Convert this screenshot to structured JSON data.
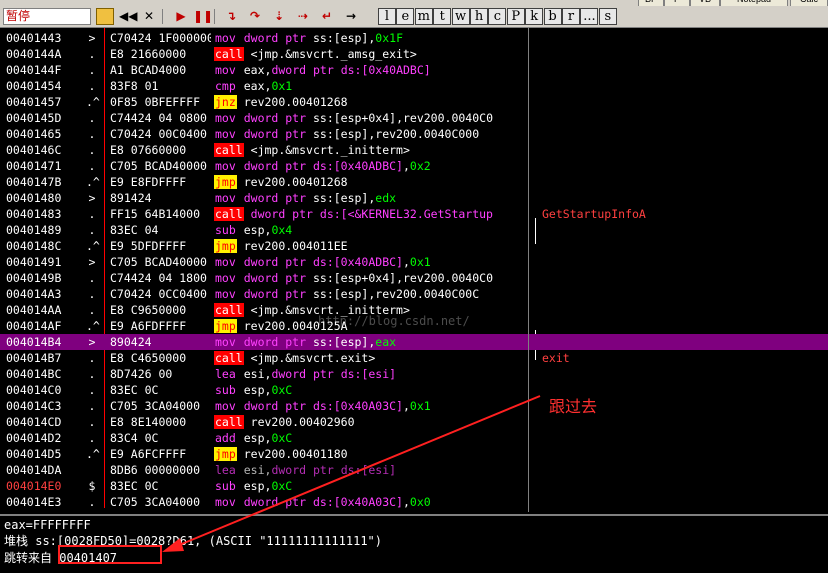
{
  "top_buttons": [
    "BP",
    "P",
    "VB",
    "Notepad",
    "Calc"
  ],
  "toolbar": {
    "status": "暂停",
    "letters": [
      "l",
      "e",
      "m",
      "t",
      "w",
      "h",
      "c",
      "P",
      "k",
      "b",
      "r",
      "...",
      "s"
    ]
  },
  "rows": [
    {
      "addr": "00401443",
      "mark": ">",
      "hex": "C70424 1F000000",
      "mn": "mov",
      "mnc": "mov",
      "ops": [
        [
          "dword ptr ",
          "kw"
        ],
        [
          "ss:[esp]",
          "reg"
        ],
        [
          ",",
          "reg"
        ],
        [
          "0x1F",
          "num"
        ]
      ],
      "comment": ""
    },
    {
      "addr": "0040144A",
      "mark": ".",
      "hex": "E8 21660000",
      "mn": "call",
      "mnc": "call",
      "ops": [
        [
          "<jmp.&msvcrt._amsg_exit>",
          "lbl"
        ]
      ],
      "comment": ""
    },
    {
      "addr": "0040144F",
      "mark": ".",
      "hex": "A1 BCAD4000",
      "mn": "mov",
      "mnc": "mov",
      "ops": [
        [
          "eax",
          "reg"
        ],
        [
          ",",
          "reg"
        ],
        [
          "dword ptr ",
          "kw"
        ],
        [
          "ds:[0x40ADBC]",
          "kw"
        ]
      ],
      "comment": ""
    },
    {
      "addr": "00401454",
      "mark": ".",
      "hex": "83F8 01",
      "mn": "cmp",
      "mnc": "cmp",
      "ops": [
        [
          "eax",
          "reg"
        ],
        [
          ",",
          "reg"
        ],
        [
          "0x1",
          "num"
        ]
      ],
      "comment": ""
    },
    {
      "addr": "00401457",
      "mark": ".^",
      "hex": "0F85 0BFEFFFF",
      "mn": "jnz",
      "mnc": "jcc",
      "ops": [
        [
          "rev200.00401268",
          "lbl"
        ]
      ],
      "comment": ""
    },
    {
      "addr": "0040145D",
      "mark": ".",
      "hex": "C74424 04 0800",
      "mn": "mov",
      "mnc": "mov",
      "ops": [
        [
          "dword ptr ",
          "kw"
        ],
        [
          "ss:[esp+0x4]",
          "reg"
        ],
        [
          ",rev200.0040C0",
          "reg"
        ]
      ],
      "comment": ""
    },
    {
      "addr": "00401465",
      "mark": ".",
      "hex": "C70424 00C0400",
      "mn": "mov",
      "mnc": "mov",
      "ops": [
        [
          "dword ptr ",
          "kw"
        ],
        [
          "ss:[esp]",
          "reg"
        ],
        [
          ",rev200.0040C000",
          "reg"
        ]
      ],
      "comment": ""
    },
    {
      "addr": "0040146C",
      "mark": ".",
      "hex": "E8 07660000",
      "mn": "call",
      "mnc": "call",
      "ops": [
        [
          "<jmp.&msvcrt._initterm>",
          "lbl"
        ]
      ],
      "comment": ""
    },
    {
      "addr": "00401471",
      "mark": ".",
      "hex": "C705 BCAD40000",
      "mn": "mov",
      "mnc": "mov",
      "ops": [
        [
          "dword ptr ",
          "kw"
        ],
        [
          "ds:[0x40ADBC]",
          "kw"
        ],
        [
          ",",
          "reg"
        ],
        [
          "0x2",
          "num"
        ]
      ],
      "comment": ""
    },
    {
      "addr": "0040147B",
      "mark": ".^",
      "hex": "E9 E8FDFFFF",
      "mn": "jmp",
      "mnc": "jmp",
      "ops": [
        [
          "rev200.00401268",
          "lbl"
        ]
      ],
      "comment": ""
    },
    {
      "addr": "00401480",
      "mark": ">",
      "hex": "891424",
      "mn": "mov",
      "mnc": "mov",
      "ops": [
        [
          "dword ptr ",
          "kw"
        ],
        [
          "ss:[esp]",
          "reg"
        ],
        [
          ",",
          "reg"
        ],
        [
          "edx",
          "num"
        ]
      ],
      "comment": ""
    },
    {
      "addr": "00401483",
      "mark": ".",
      "hex": "FF15 64B14000",
      "mn": "call",
      "mnc": "call",
      "ops": [
        [
          "dword ptr ",
          "kw"
        ],
        [
          "ds:[<&KERNEL32.GetStartup",
          "kw"
        ]
      ],
      "comment": "GetStartupInfoA"
    },
    {
      "addr": "00401489",
      "mark": ".",
      "hex": "83EC 04",
      "mn": "sub",
      "mnc": "sub",
      "ops": [
        [
          "esp",
          "reg"
        ],
        [
          ",",
          "reg"
        ],
        [
          "0x4",
          "num"
        ]
      ],
      "comment": ""
    },
    {
      "addr": "0040148C",
      "mark": ".^",
      "hex": "E9 5DFDFFFF",
      "mn": "jmp",
      "mnc": "jmp",
      "ops": [
        [
          "rev200.004011EE",
          "lbl"
        ]
      ],
      "comment": ""
    },
    {
      "addr": "00401491",
      "mark": ">",
      "hex": "C705 BCAD40000",
      "mn": "mov",
      "mnc": "mov",
      "ops": [
        [
          "dword ptr ",
          "kw"
        ],
        [
          "ds:[0x40ADBC]",
          "kw"
        ],
        [
          ",",
          "reg"
        ],
        [
          "0x1",
          "num"
        ]
      ],
      "comment": ""
    },
    {
      "addr": "0040149B",
      "mark": ".",
      "hex": "C74424 04 1800",
      "mn": "mov",
      "mnc": "mov",
      "ops": [
        [
          "dword ptr ",
          "kw"
        ],
        [
          "ss:[esp+0x4]",
          "reg"
        ],
        [
          ",rev200.0040C0",
          "reg"
        ]
      ],
      "comment": ""
    },
    {
      "addr": "004014A3",
      "mark": ".",
      "hex": "C70424 0CC0400",
      "mn": "mov",
      "mnc": "mov",
      "ops": [
        [
          "dword ptr ",
          "kw"
        ],
        [
          "ss:[esp]",
          "reg"
        ],
        [
          ",rev200.0040C00C",
          "reg"
        ]
      ],
      "comment": ""
    },
    {
      "addr": "004014AA",
      "mark": ".",
      "hex": "E8 C9650000",
      "mn": "call",
      "mnc": "call",
      "ops": [
        [
          "<jmp.&msvcrt._initterm>",
          "lbl"
        ]
      ],
      "comment": ""
    },
    {
      "addr": "004014AF",
      "mark": ".^",
      "hex": "E9 A6FDFFFF",
      "mn": "jmp",
      "mnc": "jmp",
      "ops": [
        [
          "rev200.0040125A",
          "lbl"
        ]
      ],
      "comment": ""
    },
    {
      "addr": "004014B4",
      "mark": ">",
      "hex": "890424",
      "mn": "mov",
      "mnc": "mov",
      "ops": [
        [
          "dword ptr ",
          "kw"
        ],
        [
          "ss:[esp]",
          "reg"
        ],
        [
          ",",
          "reg"
        ],
        [
          "eax",
          "num"
        ]
      ],
      "comment": "",
      "selected": true
    },
    {
      "addr": "004014B7",
      "mark": ".",
      "hex": "E8 C4650000",
      "mn": "call",
      "mnc": "call",
      "ops": [
        [
          "<jmp.&msvcrt.exit>",
          "lbl"
        ]
      ],
      "comment": "exit"
    },
    {
      "addr": "004014BC",
      "mark": ".",
      "hex": "8D7426 00",
      "mn": "lea",
      "mnc": "lea",
      "ops": [
        [
          "esi",
          "reg"
        ],
        [
          ",",
          "reg"
        ],
        [
          "dword ptr ",
          "kw"
        ],
        [
          "ds:[esi]",
          "kw"
        ]
      ],
      "comment": ""
    },
    {
      "addr": "004014C0",
      "mark": ".",
      "hex": "83EC 0C",
      "mn": "sub",
      "mnc": "sub",
      "ops": [
        [
          "esp",
          "reg"
        ],
        [
          ",",
          "reg"
        ],
        [
          "0xC",
          "num"
        ]
      ],
      "comment": ""
    },
    {
      "addr": "004014C3",
      "mark": ".",
      "hex": "C705 3CA04000",
      "mn": "mov",
      "mnc": "mov",
      "ops": [
        [
          "dword ptr ",
          "kw"
        ],
        [
          "ds:[0x40A03C]",
          "kw"
        ],
        [
          ",",
          "reg"
        ],
        [
          "0x1",
          "num"
        ]
      ],
      "comment": ""
    },
    {
      "addr": "004014CD",
      "mark": ".",
      "hex": "E8 8E140000",
      "mn": "call",
      "mnc": "call",
      "ops": [
        [
          "rev200.00402960",
          "lbl"
        ]
      ],
      "comment": ""
    },
    {
      "addr": "004014D2",
      "mark": ".",
      "hex": "83C4 0C",
      "mn": "add",
      "mnc": "add",
      "ops": [
        [
          "esp",
          "reg"
        ],
        [
          ",",
          "reg"
        ],
        [
          "0xC",
          "num"
        ]
      ],
      "comment": ""
    },
    {
      "addr": "004014D5",
      "mark": ".^",
      "hex": "E9 A6FCFFFF",
      "mn": "jmp",
      "mnc": "jmp",
      "ops": [
        [
          "rev200.00401180",
          "lbl"
        ]
      ],
      "comment": ""
    },
    {
      "addr": "004014DA",
      "mark": "",
      "hex": "8DB6 00000000",
      "mn": "lea",
      "mnc": "lea",
      "ops": [
        [
          "esi",
          "reg"
        ],
        [
          ",",
          "reg"
        ],
        [
          "dword ptr ",
          "kw"
        ],
        [
          "ds:[esi]",
          "kw"
        ]
      ],
      "comment": "",
      "dim": true
    },
    {
      "addr": "004014E0",
      "mark": "$",
      "hex": "83EC 0C",
      "mn": "sub",
      "mnc": "sub",
      "ops": [
        [
          "esp",
          "reg"
        ],
        [
          ",",
          "reg"
        ],
        [
          "0xC",
          "num"
        ]
      ],
      "comment": "",
      "addr_red": true
    },
    {
      "addr": "004014E3",
      "mark": ".",
      "hex": "C705 3CA04000",
      "mn": "mov",
      "mnc": "mov",
      "ops": [
        [
          "dword ptr ",
          "kw"
        ],
        [
          "ds:[0x40A03C]",
          "kw"
        ],
        [
          ",",
          "reg"
        ],
        [
          "0x0",
          "num"
        ]
      ],
      "comment": ""
    }
  ],
  "info": {
    "line1": "eax=FFFFFFFF",
    "line2": "堆栈 ss:[0028FD50]=0028?D61, (ASCII \"11111111111111\")",
    "line3": "跳转来自 00401407"
  },
  "annotation": "跟过去",
  "watermark": "http://blog.csdn.net/"
}
